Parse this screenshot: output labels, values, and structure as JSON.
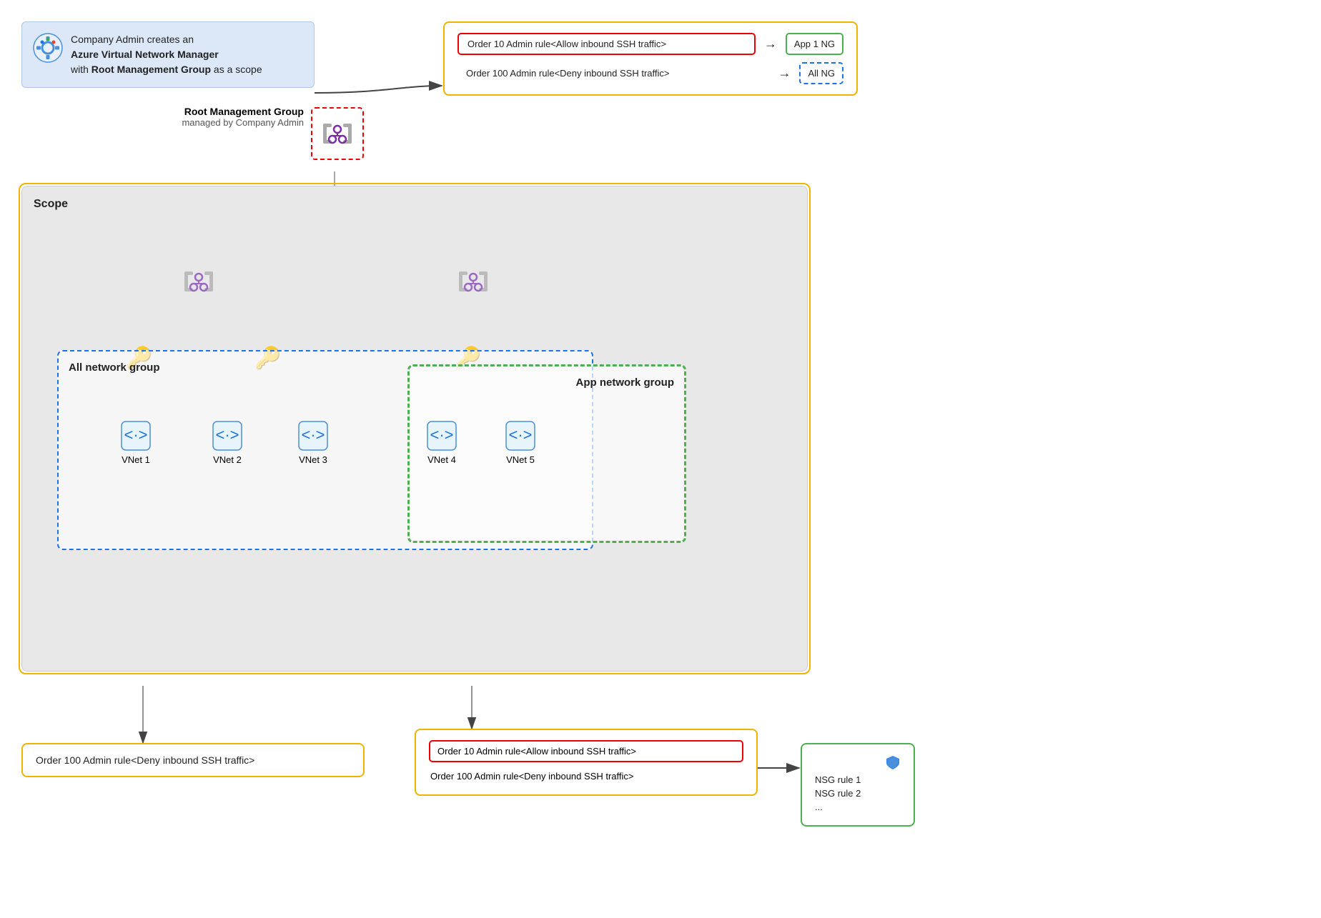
{
  "companyAdmin": {
    "line1": "Company Admin creates an",
    "line2Bold": "Azure Virtual Network Manager",
    "line3": "with",
    "line3Bold": "Root Management Group",
    "line3End": "as a scope"
  },
  "rulesPanel": {
    "rule1": {
      "text": "Order 10 Admin rule<Allow inbound SSH traffic>",
      "arrow": "→",
      "badge": "App 1 NG"
    },
    "rule2": {
      "text": "Order 100 Admin rule<Deny inbound SSH traffic>",
      "arrow": "→",
      "badge": "All NG"
    }
  },
  "rootMG": {
    "label": "Root Management Group",
    "sublabel": "managed by Company Admin"
  },
  "scope": {
    "label": "Scope"
  },
  "allNG": {
    "label": "All network group"
  },
  "appNG": {
    "label": "App network group"
  },
  "vnets": [
    "VNet 1",
    "VNet 2",
    "VNet 3",
    "VNet 4",
    "VNet 5"
  ],
  "bottomRuleLeft": {
    "text": "Order 100 Admin rule<Deny inbound SSH traffic>"
  },
  "bottomRuleRight": {
    "line1": "Order 10 Admin rule<Allow inbound SSH traffic>",
    "line2": "Order 100 Admin rule<Deny inbound SSH traffic>"
  },
  "nsgBox": {
    "line1": "NSG rule 1",
    "line2": "NSG rule 2",
    "line3": "..."
  },
  "arrows": {
    "right": "→"
  }
}
